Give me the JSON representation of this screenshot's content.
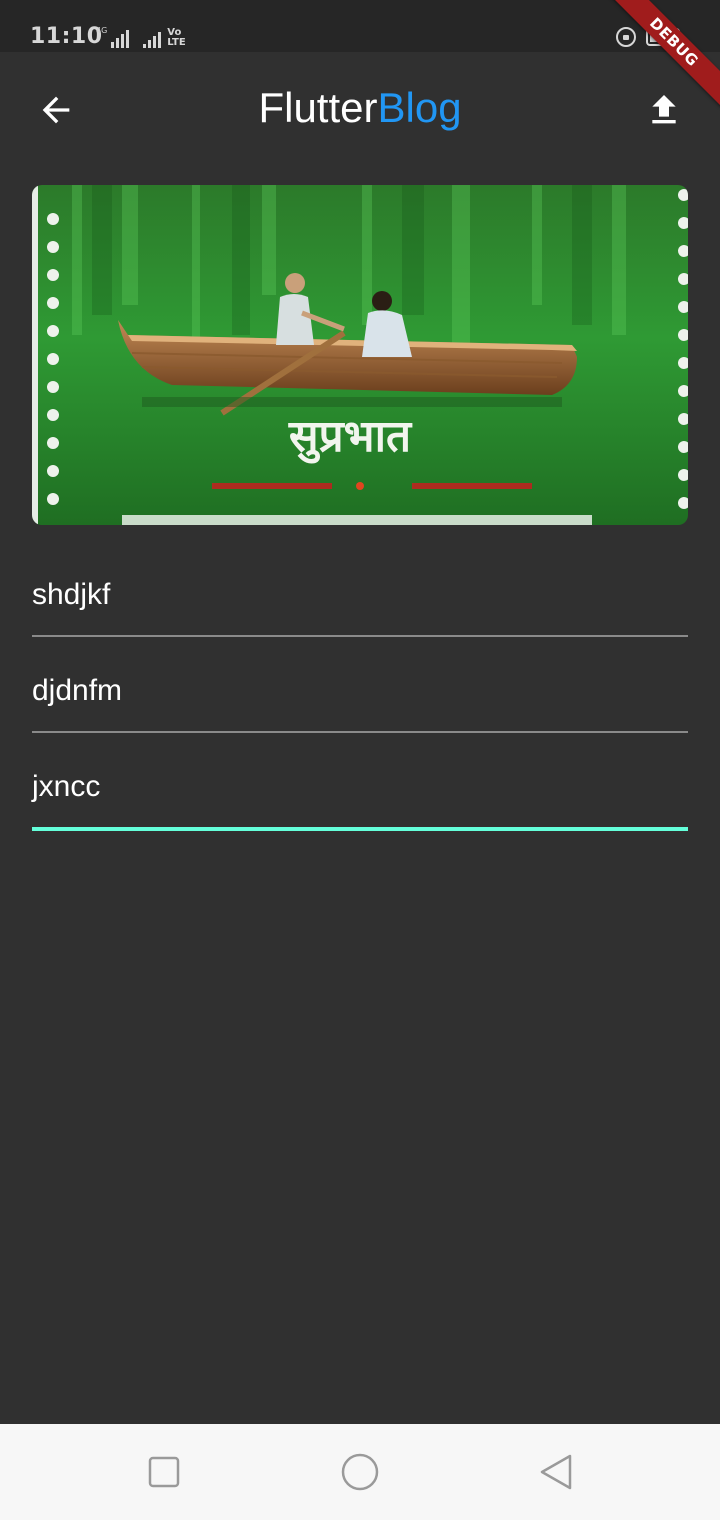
{
  "status_bar": {
    "time": "11:10",
    "signal1_label": "4G",
    "volte_line1": "Vo",
    "volte_line2": "LTE",
    "icons": [
      "signal-bars-icon",
      "rotation-lock-icon",
      "battery-icon"
    ]
  },
  "debug_banner": {
    "label": "DEBUG",
    "color": "#a01c1c"
  },
  "app_bar": {
    "title_part1": "Flutter",
    "title_part2": "Blog",
    "title_part2_color": "#2196f3",
    "leading_icon": "arrow-back-icon",
    "action_icon": "upload-icon"
  },
  "image_card": {
    "caption": "सुप्रभात"
  },
  "fields": [
    {
      "value": "shdjkf",
      "focused": false
    },
    {
      "value": "djdnfm",
      "focused": false
    },
    {
      "value": "jxncc",
      "focused": true
    }
  ],
  "colors": {
    "background": "#303030",
    "focus_underline": "#64ffda",
    "underline": "#8a8a8a"
  },
  "nav_bar": {
    "buttons": [
      "recents-icon",
      "home-icon",
      "back-icon"
    ]
  }
}
